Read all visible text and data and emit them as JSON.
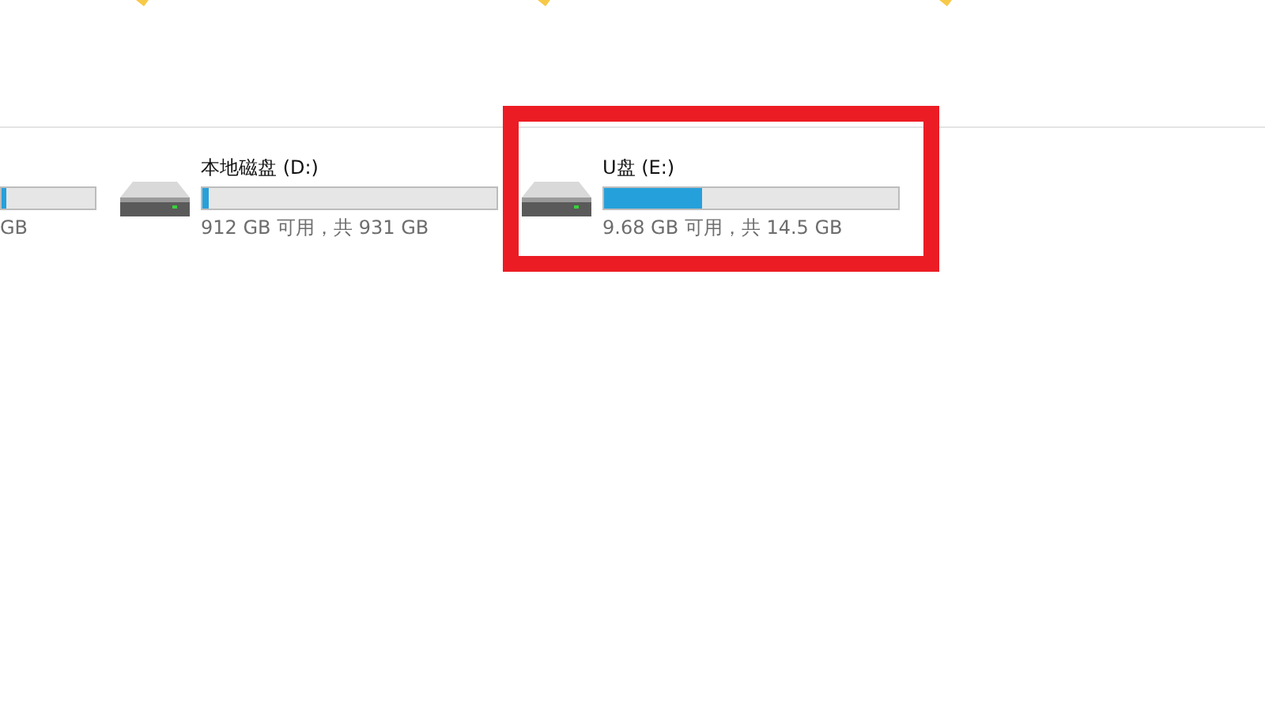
{
  "drives": [
    {
      "kind": "partial",
      "level": 0.05,
      "reading": "GB",
      "highlighted": false
    },
    {
      "kind": "full",
      "name": "本地磁盘 (D:)",
      "level": 0.02,
      "reading": "912 GB 可用，共 931 GB",
      "highlighted": false
    },
    {
      "kind": "full",
      "name": "U盘 (E:)",
      "level": 0.335,
      "reading": "9.68 GB 可用，共 14.5 GB",
      "highlighted": true
    }
  ]
}
